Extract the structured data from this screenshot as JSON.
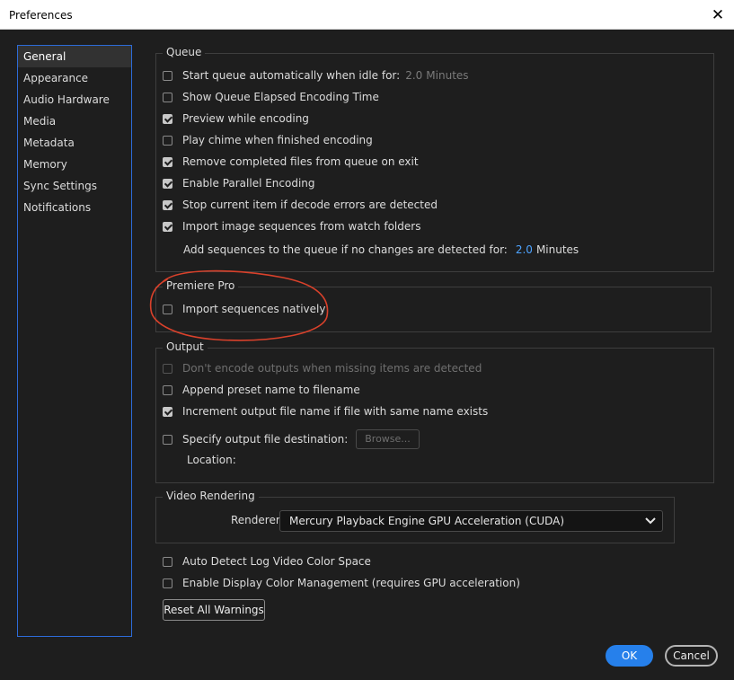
{
  "window": {
    "title": "Preferences"
  },
  "sidebar": {
    "items": [
      {
        "label": "General"
      },
      {
        "label": "Appearance"
      },
      {
        "label": "Audio Hardware"
      },
      {
        "label": "Media"
      },
      {
        "label": "Metadata"
      },
      {
        "label": "Memory"
      },
      {
        "label": "Sync Settings"
      },
      {
        "label": "Notifications"
      }
    ],
    "selected": "General"
  },
  "queue": {
    "title": "Queue",
    "start_queue": {
      "label": "Start queue automatically when idle for:",
      "checked": false,
      "value": "2.0",
      "unit": "Minutes"
    },
    "show_elapsed": {
      "label": "Show Queue Elapsed Encoding Time",
      "checked": false
    },
    "preview": {
      "label": "Preview while encoding",
      "checked": true
    },
    "chime": {
      "label": "Play chime when finished encoding",
      "checked": false
    },
    "remove_completed": {
      "label": "Remove completed files from queue on exit",
      "checked": true
    },
    "parallel": {
      "label": "Enable Parallel Encoding",
      "checked": true
    },
    "stop_on_error": {
      "label": "Stop current item if decode errors are detected",
      "checked": true
    },
    "import_image_seq": {
      "label": "Import image sequences from watch folders",
      "checked": true
    },
    "add_sequences": {
      "label": "Add sequences to the queue if no changes are detected for:",
      "value": "2.0",
      "unit": "Minutes"
    }
  },
  "premiere": {
    "title": "Premiere Pro",
    "import_natively": {
      "label": "Import sequences natively",
      "checked": false
    }
  },
  "output": {
    "title": "Output",
    "dont_encode": {
      "label": "Don't encode outputs when missing items are detected",
      "checked": false,
      "disabled": true
    },
    "append_preset": {
      "label": "Append preset name to filename",
      "checked": false
    },
    "increment": {
      "label": "Increment output file name if file with same name exists",
      "checked": true
    },
    "specify_dest": {
      "label": "Specify output file destination:",
      "checked": false
    },
    "browse_label": "Browse...",
    "location_label": "Location:"
  },
  "video_rendering": {
    "title": "Video Rendering",
    "renderer_label": "Renderer:",
    "renderer_value": "Mercury Playback Engine GPU Acceleration (CUDA)"
  },
  "misc": {
    "auto_detect": {
      "label": "Auto Detect Log Video Color Space",
      "checked": false
    },
    "display_color": {
      "label": "Enable Display Color Management (requires GPU acceleration)",
      "checked": false
    },
    "reset_warnings": "Reset All Warnings"
  },
  "footer": {
    "ok": "OK",
    "cancel": "Cancel"
  },
  "colors": {
    "accent": "#2680eb",
    "value_link": "#4da3ff",
    "annotation": "#d9412b",
    "background": "#1e1e1e"
  }
}
